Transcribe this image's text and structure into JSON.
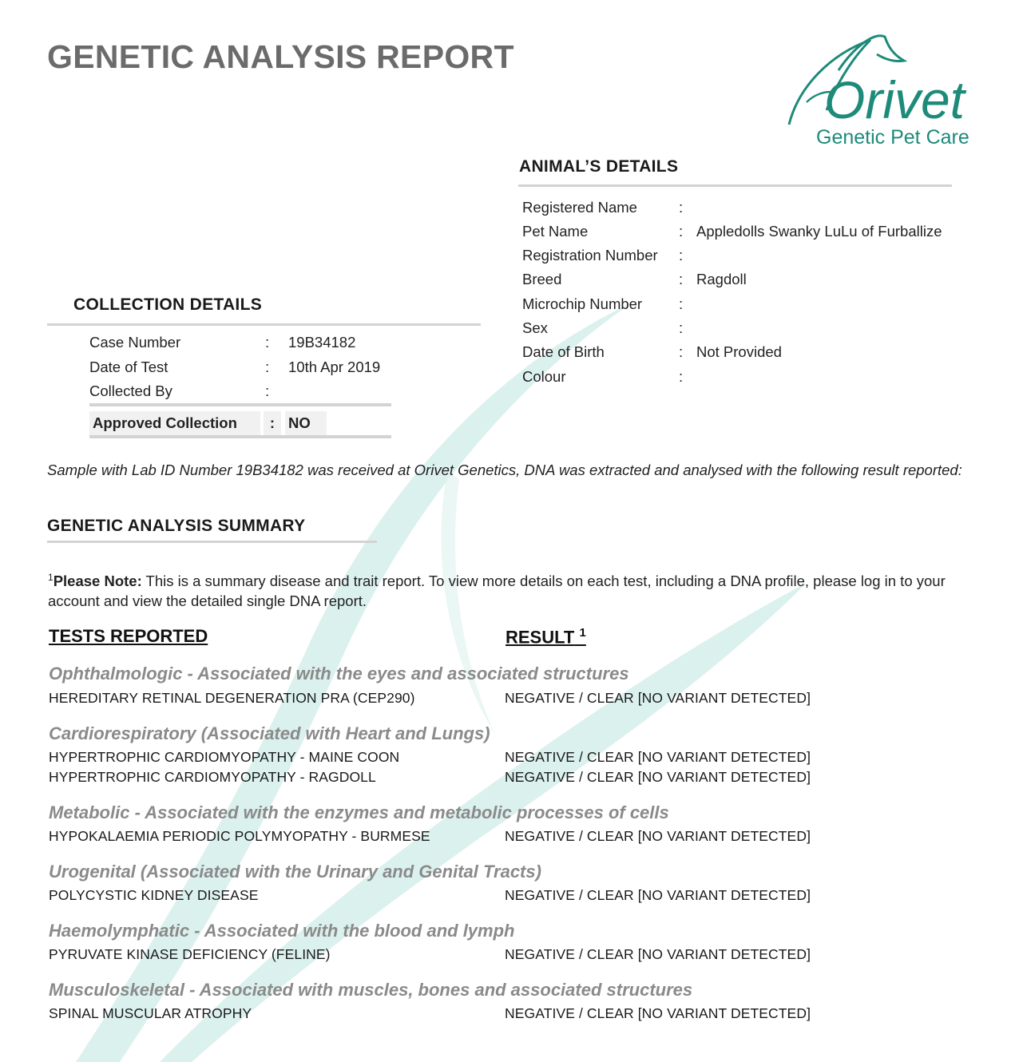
{
  "report": {
    "title": "GENETIC ANALYSIS REPORT",
    "logo_text": "Orivet",
    "logo_tagline": "Genetic Pet Care",
    "brand_color": "#1d8a7a"
  },
  "animal": {
    "heading": "ANIMAL’S DETAILS",
    "rows": [
      {
        "label": "Registered Name",
        "value": ""
      },
      {
        "label": "Pet Name",
        "value": "Appledolls Swanky LuLu of Furballize"
      },
      {
        "label": "Registration Number",
        "value": ""
      },
      {
        "label": "Breed",
        "value": "Ragdoll"
      },
      {
        "label": "Microchip Number",
        "value": ""
      },
      {
        "label": "Sex",
        "value": ""
      },
      {
        "label": "Date of Birth",
        "value": "Not Provided"
      },
      {
        "label": "Colour",
        "value": ""
      }
    ]
  },
  "collection": {
    "heading": "COLLECTION DETAILS",
    "rows": [
      {
        "label": "Case Number",
        "value": "19B34182"
      },
      {
        "label": "Date of Test",
        "value": "10th Apr 2019"
      },
      {
        "label": "Collected By",
        "value": ""
      }
    ],
    "approved_label": "Approved Collection",
    "approved_value": "NO"
  },
  "intro_text": "Sample with Lab ID Number 19B34182 was received at Orivet Genetics, DNA was extracted and analysed with the following result reported:",
  "summary": {
    "heading": "GENETIC ANALYSIS SUMMARY",
    "note_sup": "1",
    "note_bold": "Please Note:",
    "note_text": " This is a summary disease and trait report. To view more details on each test, including a DNA profile, please log in to your account and view the detailed single DNA report."
  },
  "table": {
    "col_tests": "TESTS REPORTED",
    "col_result": "RESULT",
    "col_result_sup": "1",
    "categories": [
      {
        "name": "Ophthalmologic - Associated with the eyes and associated structures",
        "tests": [
          {
            "name": "HEREDITARY RETINAL DEGENERATION PRA (CEP290)",
            "result": "NEGATIVE / CLEAR [NO VARIANT DETECTED]"
          }
        ]
      },
      {
        "name": "Cardiorespiratory (Associated with Heart and Lungs)",
        "tests": [
          {
            "name": "HYPERTROPHIC CARDIOMYOPATHY - MAINE COON",
            "result": "NEGATIVE / CLEAR [NO VARIANT DETECTED]"
          },
          {
            "name": "HYPERTROPHIC CARDIOMYOPATHY - RAGDOLL",
            "result": "NEGATIVE / CLEAR [NO VARIANT DETECTED]"
          }
        ]
      },
      {
        "name": "Metabolic - Associated with the enzymes and metabolic processes of cells",
        "tests": [
          {
            "name": "HYPOKALAEMIA PERIODIC POLYMYOPATHY - BURMESE",
            "result": "NEGATIVE / CLEAR [NO VARIANT DETECTED]"
          }
        ]
      },
      {
        "name": "Urogenital (Associated with the Urinary and Genital Tracts)",
        "tests": [
          {
            "name": "POLYCYSTIC KIDNEY DISEASE",
            "result": "NEGATIVE / CLEAR [NO VARIANT DETECTED]"
          }
        ]
      },
      {
        "name": "Haemolymphatic - Associated with the blood and lymph",
        "tests": [
          {
            "name": "PYRUVATE KINASE DEFICIENCY (FELINE)",
            "result": "NEGATIVE / CLEAR [NO VARIANT DETECTED]"
          }
        ]
      },
      {
        "name": "Musculoskeletal - Associated with muscles, bones and associated structures",
        "tests": [
          {
            "name": "SPINAL MUSCULAR ATROPHY",
            "result": "NEGATIVE / CLEAR [NO VARIANT DETECTED]"
          }
        ]
      }
    ]
  }
}
